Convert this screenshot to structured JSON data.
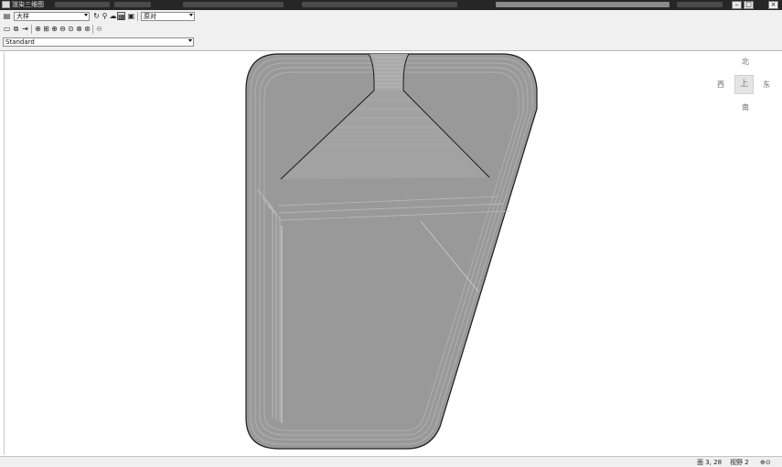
{
  "window": {
    "title": "渲染三维图",
    "minimize": "–",
    "maximize": "□",
    "close": "×"
  },
  "toolbar": {
    "layer_icon": "layer-icon",
    "view_combo": {
      "value": "大样"
    },
    "render_combo": {
      "value": "原对"
    },
    "style_combo": {
      "value": "Standard"
    },
    "colors": {
      "toolbar_bg": "#f0f0f0",
      "shape_fill": "#999999",
      "shape_stroke": "#1a1a1a"
    }
  },
  "compass": {
    "north": "北",
    "south": "南",
    "west": "西",
    "east": "东",
    "center": "上"
  },
  "status": {
    "left": "面 3, 28",
    "middle": "视野 2",
    "right": "⊕⊙"
  }
}
